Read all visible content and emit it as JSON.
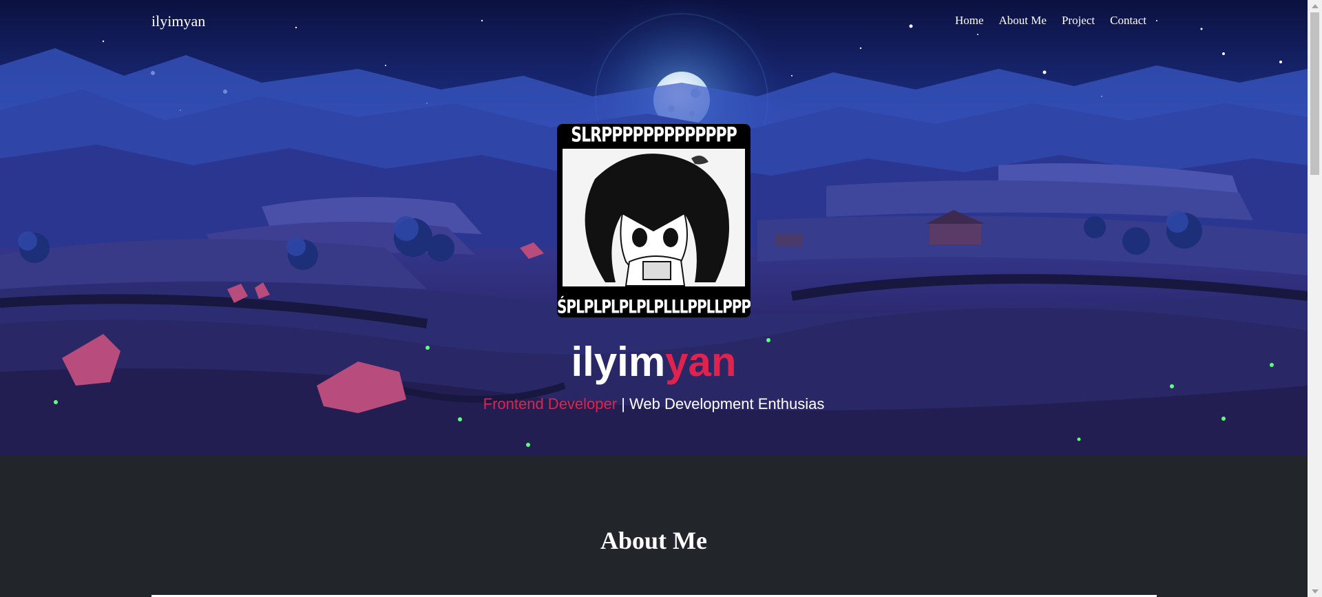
{
  "nav": {
    "brand": "ilyimyan",
    "links": [
      "Home",
      "About Me",
      "Project",
      "Contact"
    ]
  },
  "hero": {
    "avatar": {
      "caption_top": "SLRPPPPPPPPPPPPP",
      "caption_bottom": "ŚPLPLPLPLPLPLLLPPLLPPPS",
      "alt": "manga girl sipping drink"
    },
    "name_main": "ilyim",
    "name_accent": "yan",
    "tagline_accent": "Frontend Developer",
    "tagline_rest": " | Web Development Enthusias"
  },
  "about": {
    "title": "About Me"
  },
  "colors": {
    "accent": "#e0234e",
    "about_bg": "#222529",
    "night_sky": "#1a2a7a"
  }
}
